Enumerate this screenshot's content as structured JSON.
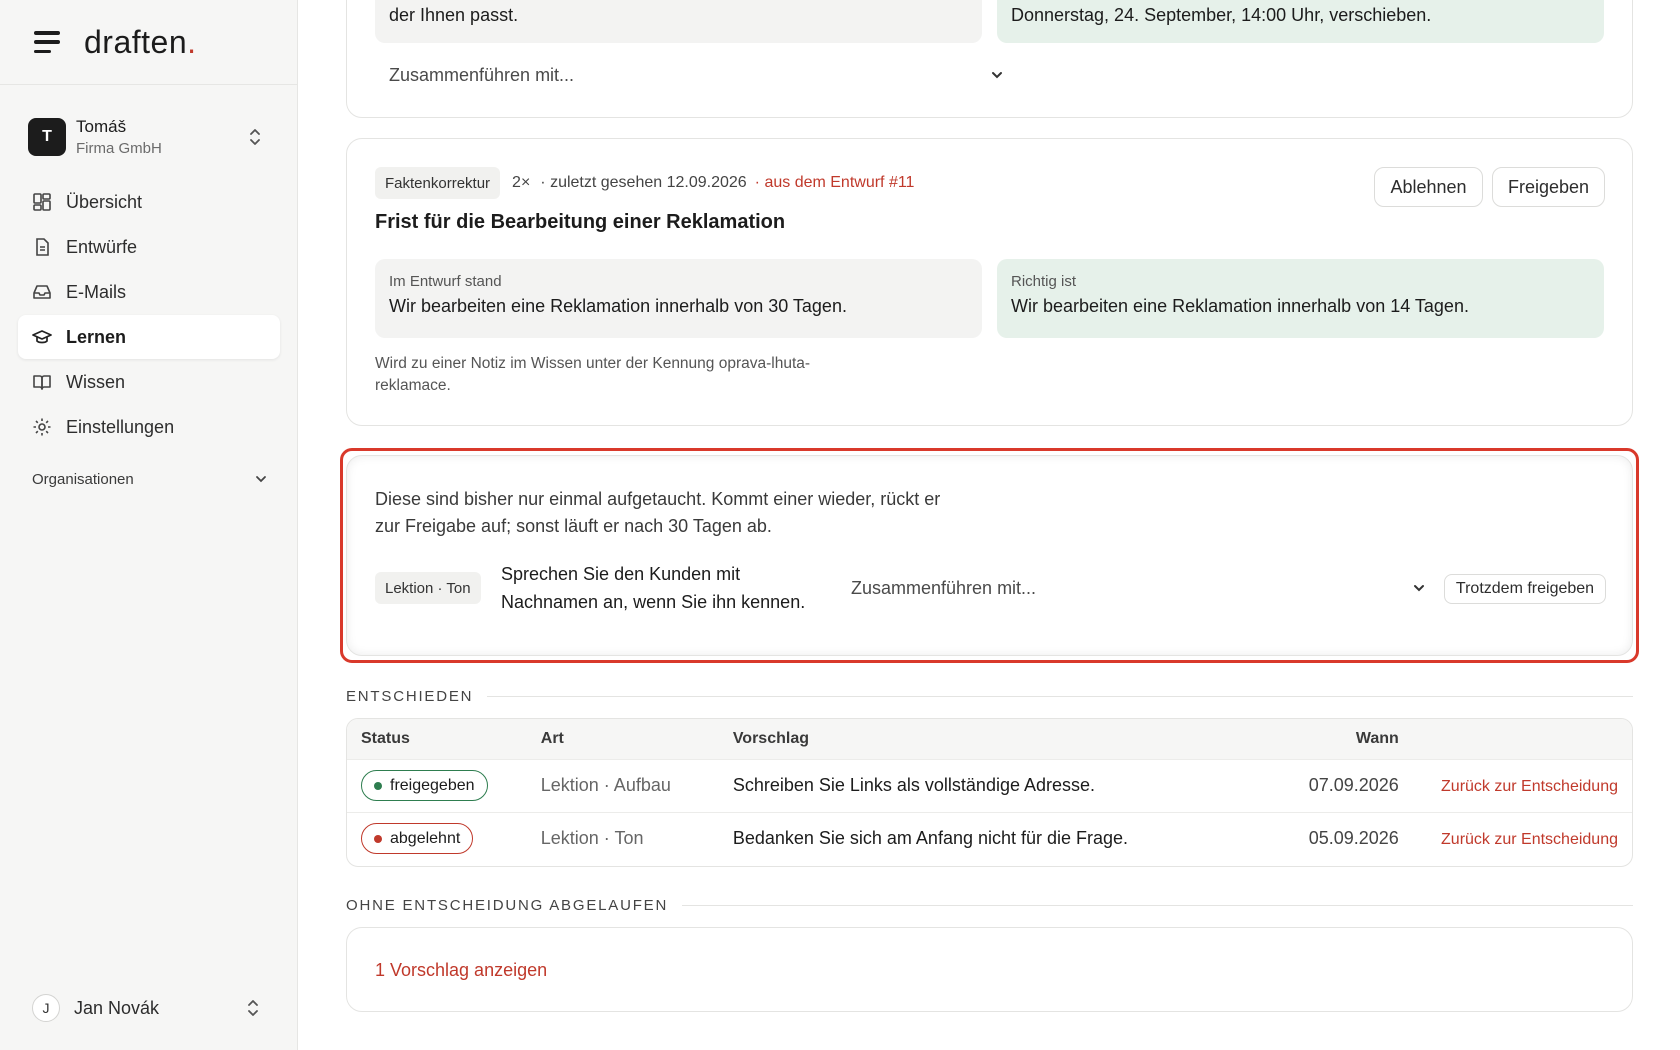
{
  "brand": {
    "name": "draften",
    "dot": "."
  },
  "account": {
    "initial": "T",
    "name": "Tomáš",
    "company": "Firma GmbH"
  },
  "nav": {
    "items": [
      {
        "label": "Übersicht",
        "icon": "dashboard-icon"
      },
      {
        "label": "Entwürfe",
        "icon": "document-icon"
      },
      {
        "label": "E-Mails",
        "icon": "inbox-icon"
      },
      {
        "label": "Lernen",
        "icon": "graduation-cap-icon",
        "active": true
      },
      {
        "label": "Wissen",
        "icon": "book-icon"
      },
      {
        "label": "Einstellungen",
        "icon": "gear-icon"
      }
    ],
    "org_label": "Organisationen"
  },
  "user": {
    "initial": "J",
    "name": "Jan Novák"
  },
  "card1": {
    "left_text": "der Ihnen passt.",
    "right_text": "Donnerstag, 24. September, 14:00 Uhr, verschieben.",
    "merge_placeholder": "Zusammenführen mit..."
  },
  "card2": {
    "tag": "Faktenkorrektur",
    "count": "2×",
    "seen": "· zuletzt gesehen 12.09.2026",
    "source": "· aus dem Entwurf #11",
    "title": "Frist für die Bearbeitung einer Reklamation",
    "reject_label": "Ablehnen",
    "approve_label": "Freigeben",
    "draft_label": "Im Entwurf stand",
    "draft_text": "Wir bearbeiten eine Reklamation innerhalb von 30 Tagen.",
    "correct_label": "Richtig ist",
    "correct_text": "Wir bearbeiten eine Reklamation innerhalb von 14 Tagen.",
    "note_line1": "Wird zu einer Notiz im Wissen unter der Kennung oprava-lhuta-",
    "note_line2": "reklamace."
  },
  "card3": {
    "info_line1": "Diese sind bisher nur einmal aufgetaucht. Kommt einer wieder, rückt er",
    "info_line2": "zur Freigabe auf; sonst läuft er nach 30 Tagen ab.",
    "tag": "Lektion · Ton",
    "suggestion_line1": "Sprechen Sie den Kunden mit",
    "suggestion_line2": "Nachnamen an, wenn Sie ihn kennen.",
    "merge_placeholder": "Zusammenführen mit...",
    "approve_anyway_label": "Trotzdem freigeben",
    "highlight_color": "#d9392b"
  },
  "decided": {
    "title": "ENTSCHIEDEN",
    "columns": [
      "Status",
      "Art",
      "Vorschlag",
      "Wann"
    ],
    "rows": [
      {
        "status": "freigegeben",
        "art": "Lektion · Aufbau",
        "vorschlag": "Schreiben Sie Links als vollständige Adresse.",
        "wann": "07.09.2026",
        "action": "Zurück zur Entscheidung"
      },
      {
        "status": "abgelehnt",
        "art": "Lektion · Ton",
        "vorschlag": "Bedanken Sie sich am Anfang nicht für die Frage.",
        "wann": "05.09.2026",
        "action": "Zurück zur Entscheidung"
      }
    ]
  },
  "expired": {
    "title": "OHNE ENTSCHEIDUNG ABGELAUFEN",
    "show_label": "1 Vorschlag anzeigen"
  },
  "colors": {
    "accent_red": "#c0392b",
    "green": "#2e7d4f",
    "green_bg": "#e6f1ea"
  }
}
